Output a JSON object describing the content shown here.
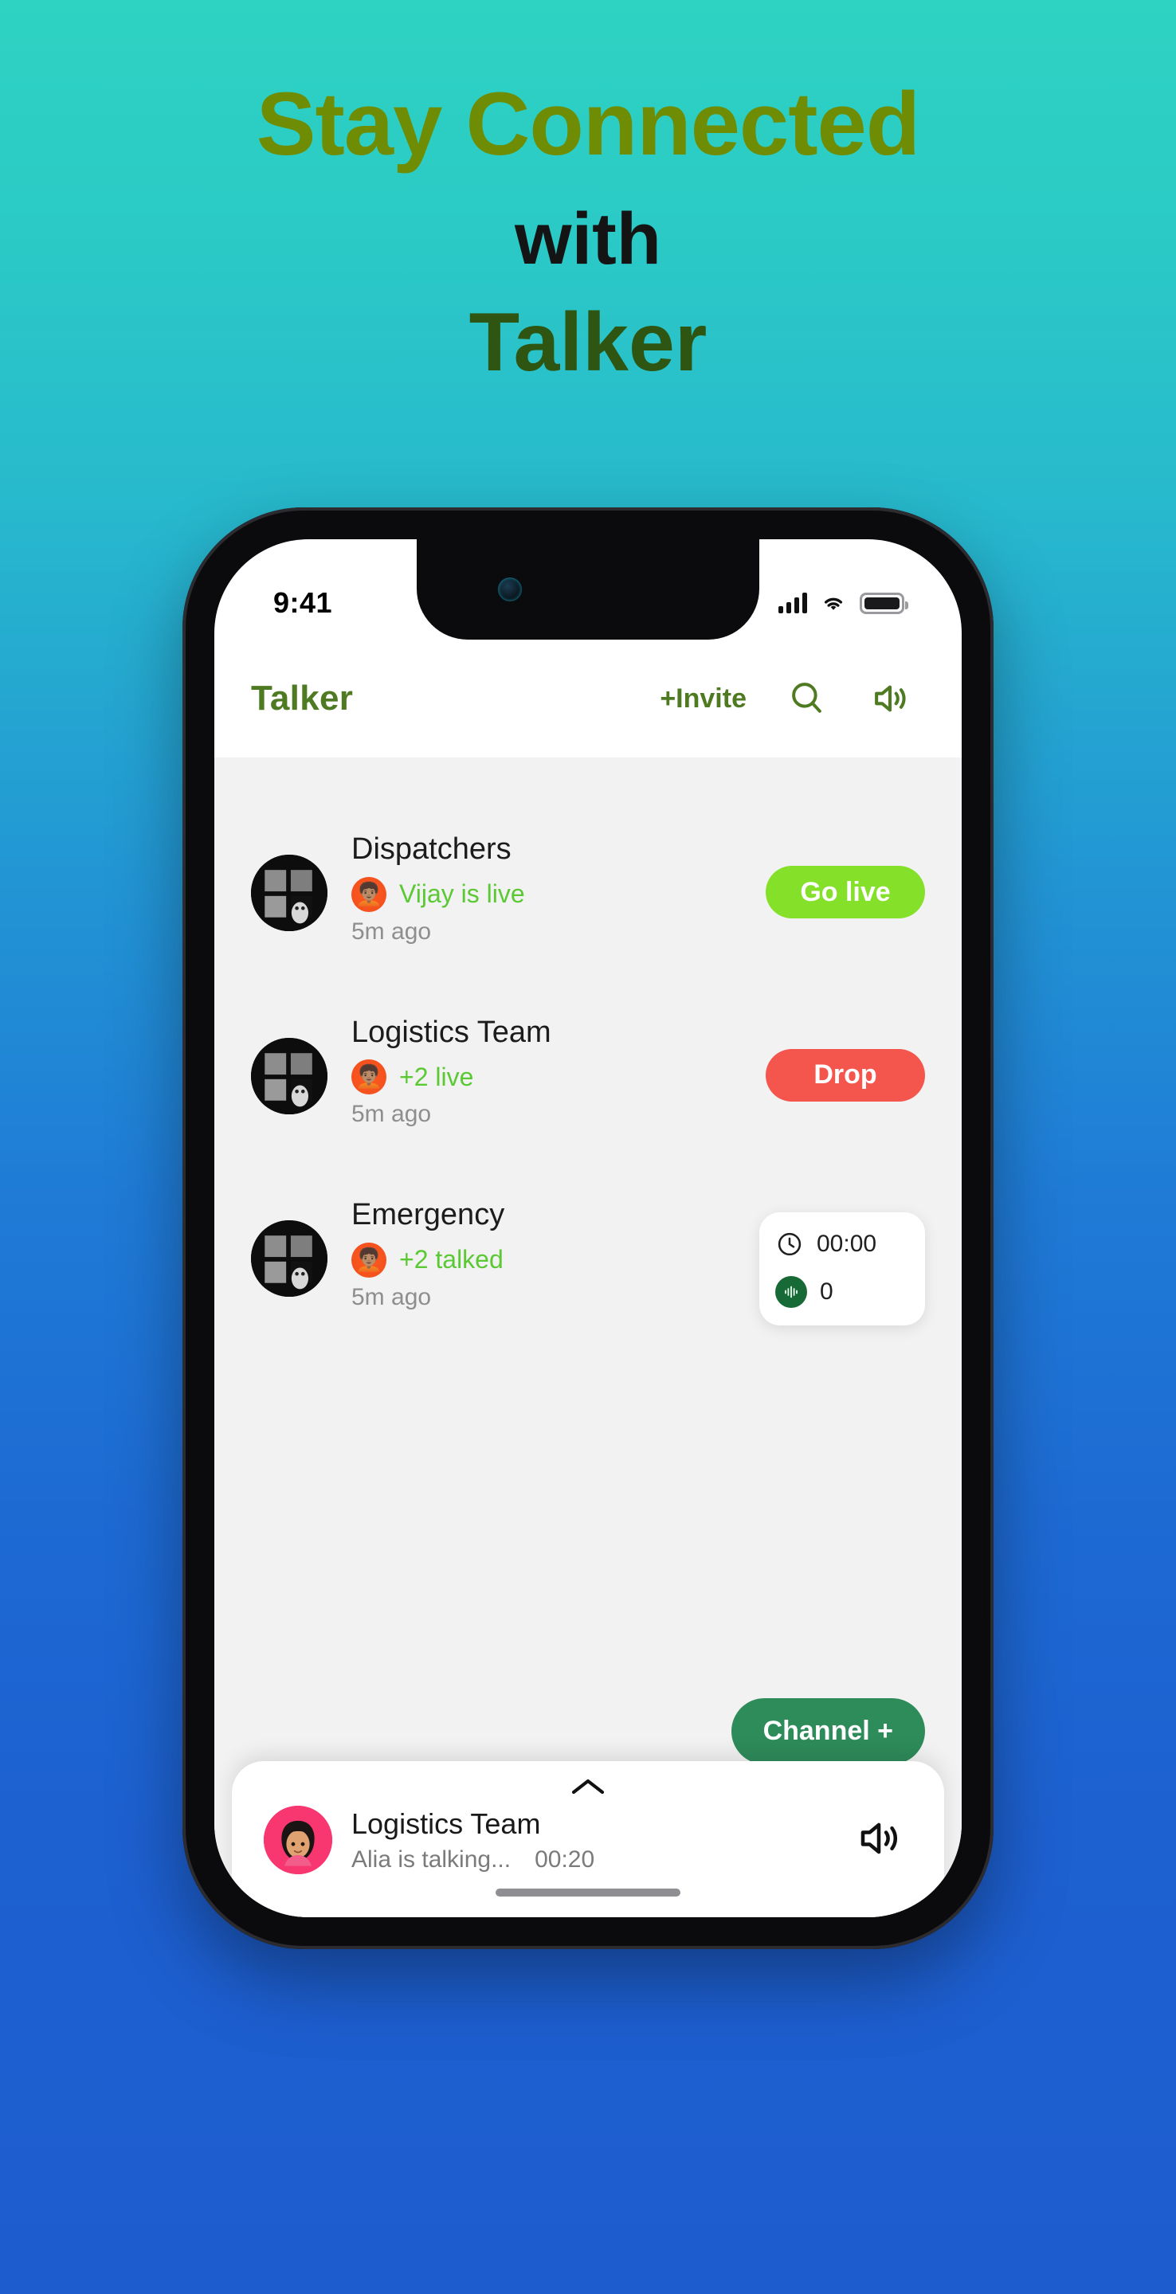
{
  "hero": {
    "line1": "Stay Connected",
    "line2": "with",
    "line3": "Talker",
    "colors": {
      "line1": "#6F8C05",
      "line2": "#141414",
      "line3": "#2F5512"
    }
  },
  "background": {
    "top": "#2ED3C2",
    "bottom": "#1D5CCF"
  },
  "phone": {
    "status_bar": {
      "time": "9:41",
      "signal": "signal-bars",
      "wifi": "wifi",
      "battery": "battery-full"
    },
    "app": {
      "header": {
        "brand": "Talker",
        "invite_label": "+Invite",
        "search_icon": "search-icon",
        "speaker_icon": "speaker-icon"
      },
      "channels": [
        {
          "name": "Dispatchers",
          "status": "Vijay is live",
          "time": "5m ago",
          "action": {
            "type": "button",
            "label": "Go live",
            "color": "#84E028"
          }
        },
        {
          "name": "Logistics Team",
          "status": "+2 live",
          "time": "5m ago",
          "action": {
            "type": "button",
            "label": "Drop",
            "color": "#F4554C"
          }
        },
        {
          "name": "Emergency",
          "status": "+2 talked",
          "time": "5m ago",
          "action": {
            "type": "timer-card",
            "clock_icon": "clock-icon",
            "duration": "00:00",
            "wave_icon": "waveform-icon",
            "count": "0"
          }
        }
      ],
      "fab": {
        "label": "Channel +",
        "color": "#2E8B5A"
      },
      "player": {
        "chevron_icon": "chevron-up-icon",
        "title": "Logistics Team",
        "subtitle": "Alia is talking...",
        "elapsed": "00:20",
        "speaker_icon": "speaker-icon"
      }
    }
  }
}
